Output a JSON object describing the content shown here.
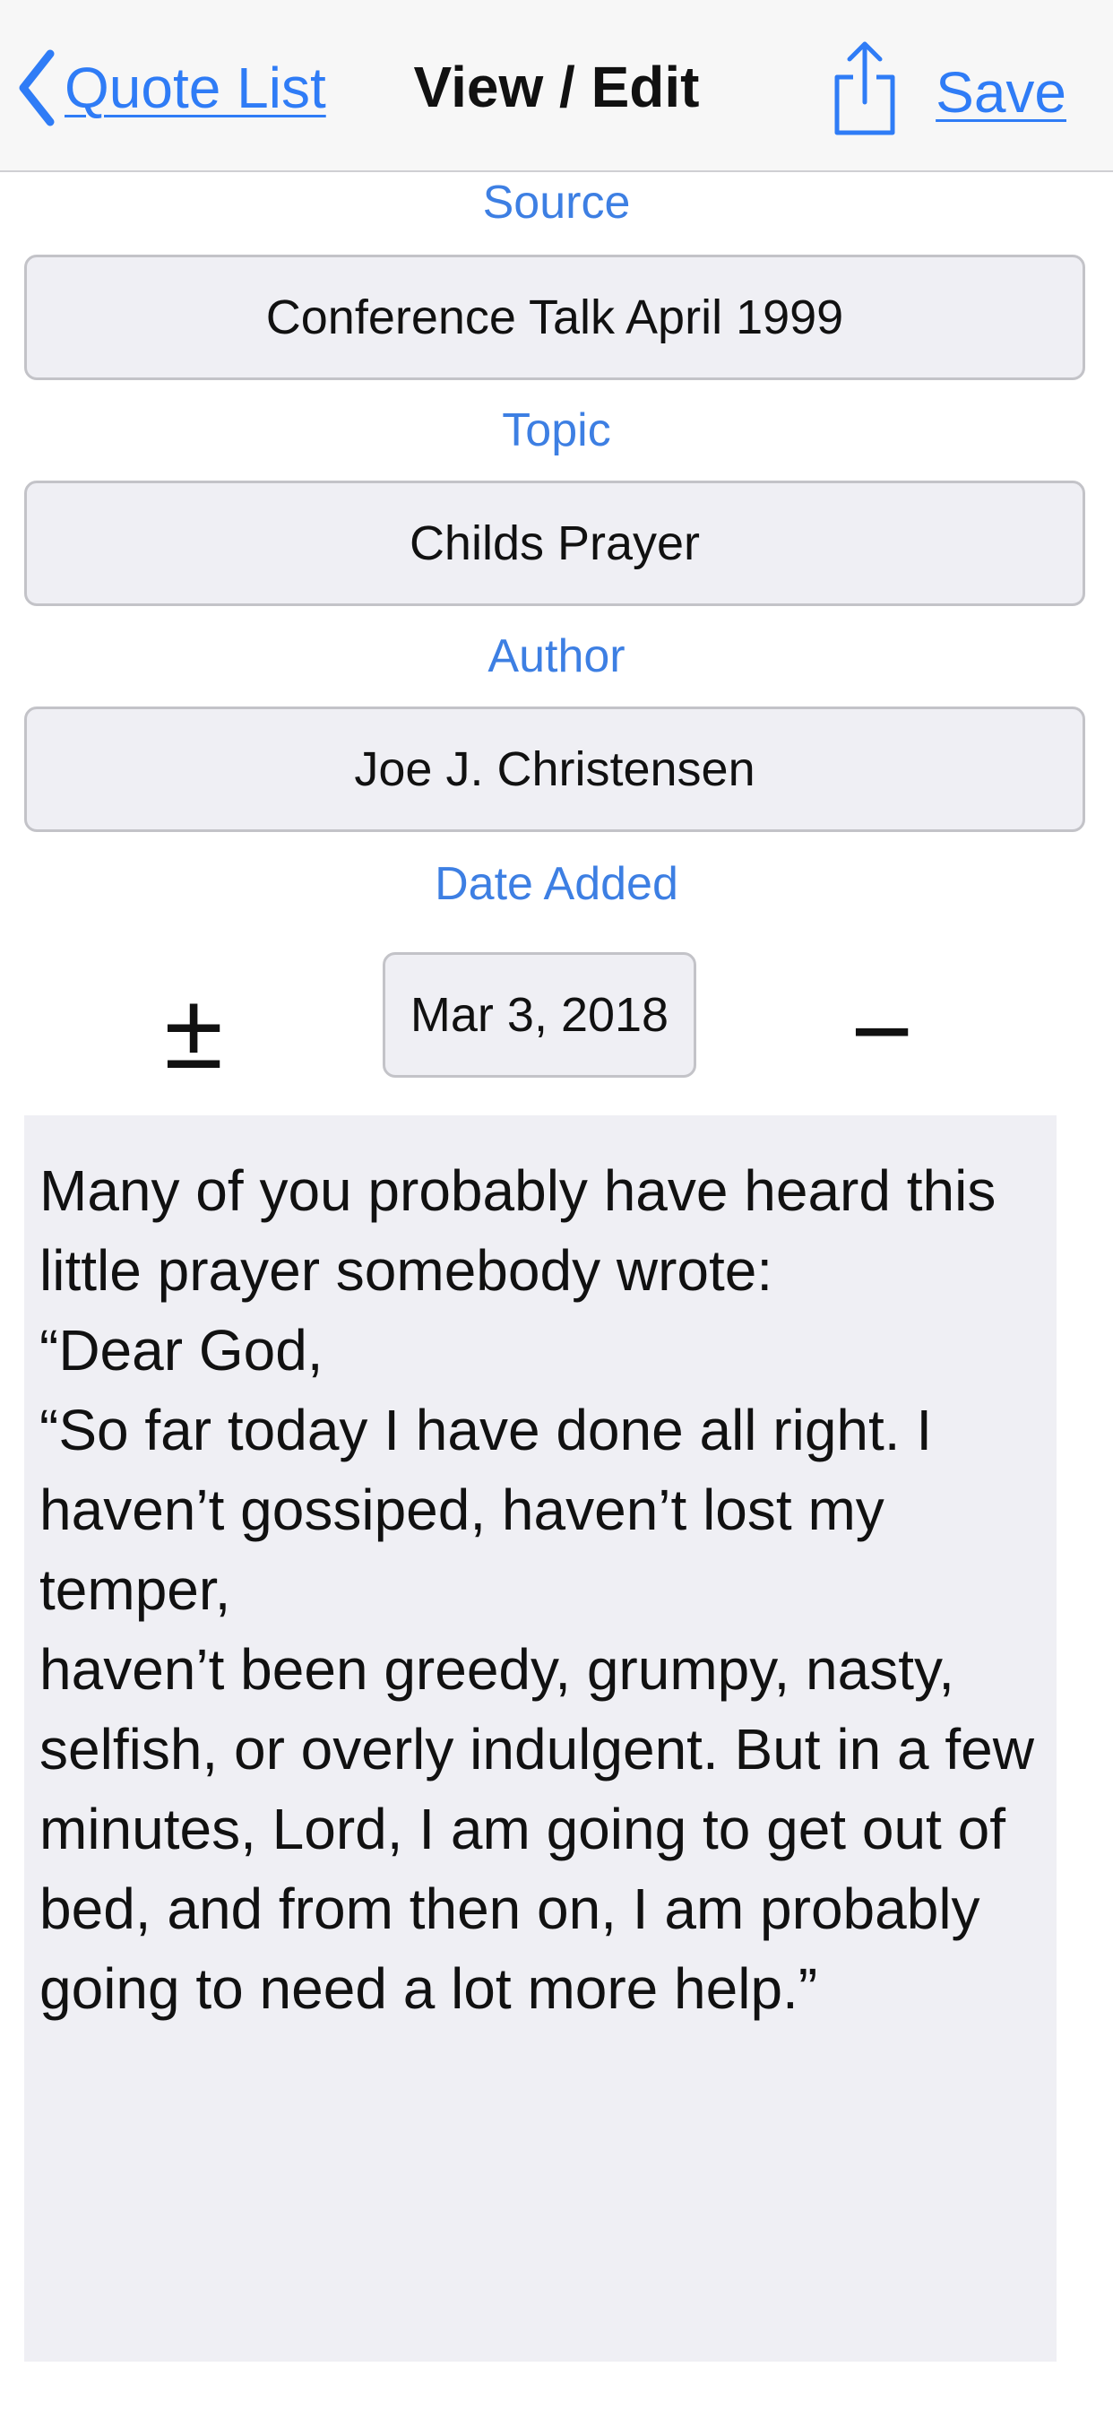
{
  "nav": {
    "back_label": "Quote List",
    "title": "View / Edit",
    "save_label": "Save",
    "back_icon": "chevron-left-icon",
    "share_icon": "share-icon"
  },
  "fields": {
    "source": {
      "label": "Source",
      "value": "Conference Talk April 1999"
    },
    "topic": {
      "label": "Topic",
      "value": "Childs Prayer"
    },
    "author": {
      "label": "Author",
      "value": "Joe J. Christensen"
    }
  },
  "date": {
    "label": "Date Added",
    "value": "Mar 3, 2018",
    "increment_label": "±",
    "decrement_label": "−"
  },
  "quote": {
    "text": "Many of you probably have heard this\nlittle prayer somebody wrote:\n“Dear God,\n“So far today I have done all right. I\nhaven’t gossiped, haven’t lost my temper,\nhaven’t been greedy, grumpy, nasty,\nselfish, or overly indulgent. But in a few\nminutes, Lord, I am going to get out of\nbed, and from then on, I am probably\ngoing to need a lot more help.”"
  },
  "colors": {
    "accent": "#2f7cf6",
    "label": "#3d7fe3",
    "field_bg": "#efeff4",
    "nav_bg": "#f7f7f7"
  }
}
